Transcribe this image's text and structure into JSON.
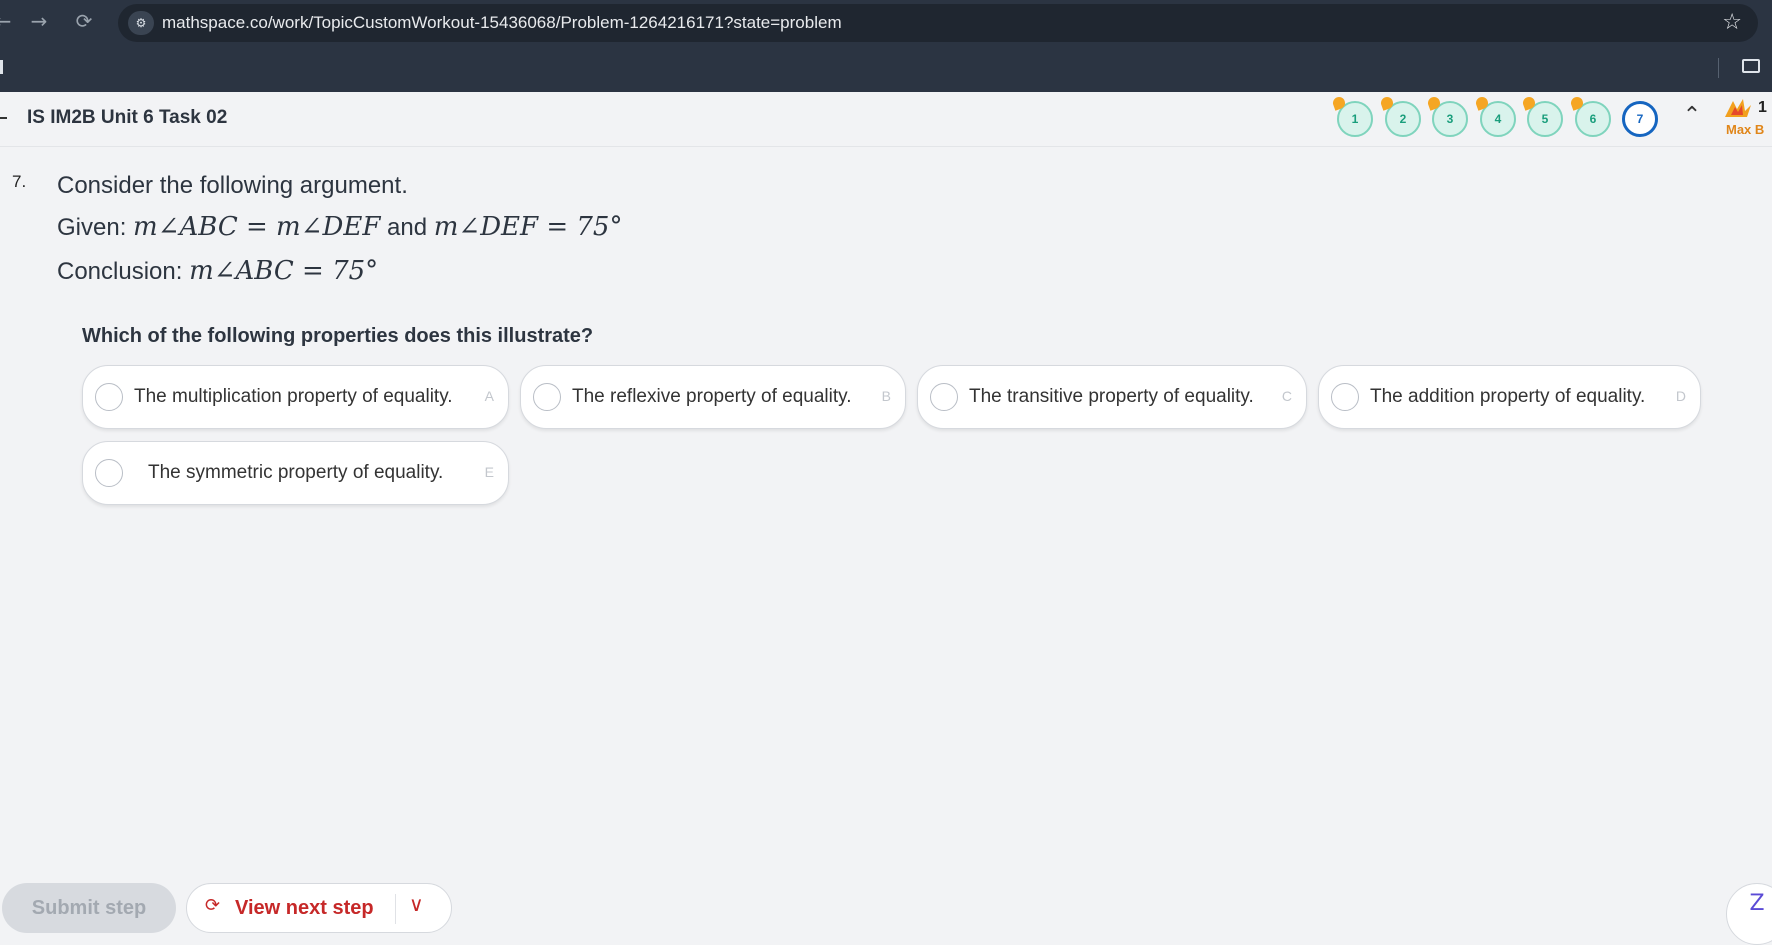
{
  "browser": {
    "back_icon": "←",
    "forward_icon": "→",
    "reload_icon": "⟳",
    "url": "mathspace.co/work/TopicCustomWorkout-15436068/Problem-1264216171?state=problem",
    "star_icon": "☆"
  },
  "header": {
    "task_title": "IS IM2B Unit 6 Task 02",
    "questions": [
      {
        "label": "1",
        "status": "complete"
      },
      {
        "label": "2",
        "status": "complete"
      },
      {
        "label": "3",
        "status": "complete"
      },
      {
        "label": "4",
        "status": "complete"
      },
      {
        "label": "5",
        "status": "complete"
      },
      {
        "label": "6",
        "status": "complete"
      },
      {
        "label": "7",
        "status": "current"
      }
    ],
    "collapse_icon": "⌃",
    "badge_count": "1",
    "badge_label": "Max B"
  },
  "problem": {
    "number": "7.",
    "intro": "Consider the following argument.",
    "given_label": "Given:",
    "given_math_1": "m∠ABC = m∠DEF",
    "and_word": "and",
    "given_math_2": "m∠DEF = 75°",
    "conclusion_label": "Conclusion:",
    "conclusion_math": "m∠ABC = 75°",
    "prompt": "Which of the following properties does this illustrate?",
    "options": [
      {
        "text": "The multiplication property of equality.",
        "letter": "A"
      },
      {
        "text": "The reflexive property of equality.",
        "letter": "B"
      },
      {
        "text": "The transitive property of equality.",
        "letter": "C"
      },
      {
        "text": "The addition property of equality.",
        "letter": "D"
      },
      {
        "text": "The symmetric property of equality.",
        "letter": "E"
      }
    ]
  },
  "footer": {
    "submit_label": "Submit step",
    "next_label": "View next step",
    "next_icon": "⟳",
    "dropdown_icon": "∨",
    "help_icon": "Z"
  }
}
